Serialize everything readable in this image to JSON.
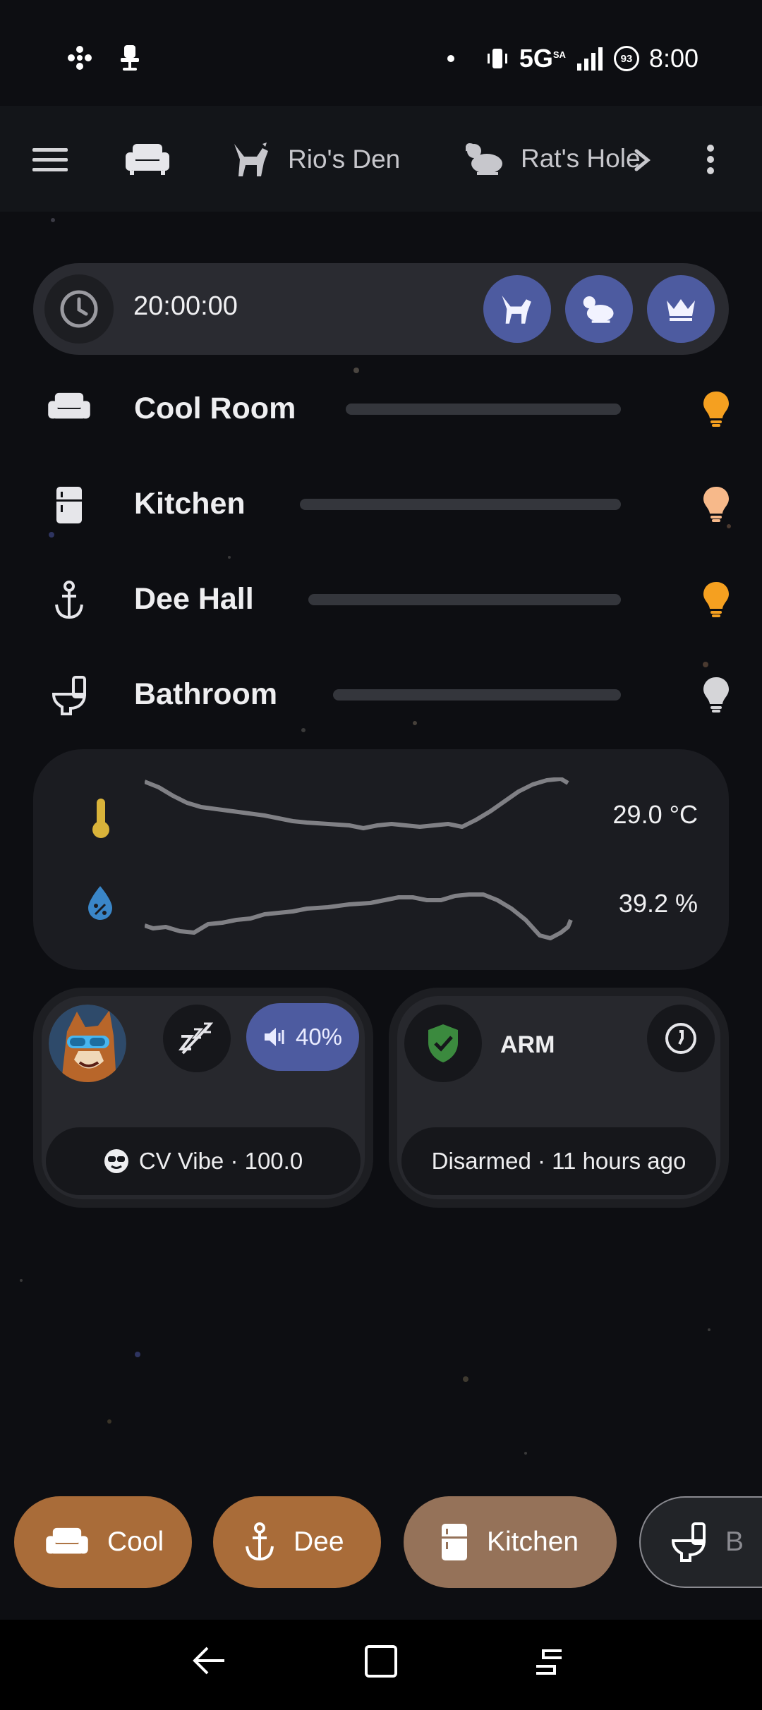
{
  "status_bar": {
    "left_icons": [
      "fan-icon",
      "office-chair-icon"
    ],
    "network": "5G",
    "network_superscript": "SA",
    "battery_level": "93",
    "time": "8:00"
  },
  "top_nav": {
    "menu_icon": "hamburger-icon",
    "home_icon": "sofa-icon",
    "tabs": [
      {
        "icon": "dog-icon",
        "label": "Rio's Den"
      },
      {
        "icon": "rat-icon",
        "label": "Rat's Hole"
      }
    ],
    "overflow_icon": "more-vert-icon"
  },
  "clock": {
    "time": "20:00:00",
    "buttons": [
      "dog-icon",
      "rat-icon",
      "crown-icon"
    ]
  },
  "rooms": [
    {
      "label": "Cool Room",
      "icon": "sofa-icon",
      "bulb_color": "#f5a020",
      "bulb_on": true
    },
    {
      "label": "Kitchen",
      "icon": "fridge-icon",
      "bulb_color": "#f7b98a",
      "bulb_on": true
    },
    {
      "label": "Dee Hall",
      "icon": "anchor-icon",
      "bulb_color": "#f5a020",
      "bulb_on": true
    },
    {
      "label": "Bathroom",
      "icon": "toilet-icon",
      "bulb_color": "#d5d5d8",
      "bulb_on": false
    }
  ],
  "environment": {
    "temperature": "29.0 °C",
    "humidity": "39.2 %",
    "temperature_color": "#d9b33a",
    "humidity_color": "#3a86c8"
  },
  "media_card": {
    "sleep_icon": "sleep-off-icon",
    "volume_icon": "volume-icon",
    "volume": "40%",
    "vibe_icon": "sunglasses-icon",
    "vibe_label": "CV Vibe · 100.0"
  },
  "alarm_card": {
    "shield_icon": "shield-check-icon",
    "arm_label": "ARM",
    "action_icon": "history-icon",
    "status": "Disarmed · 11 hours ago"
  },
  "chips": [
    {
      "icon": "sofa-icon",
      "label": "Cool",
      "bg": "#a96c39"
    },
    {
      "icon": "anchor-icon",
      "label": "Dee",
      "bg": "#a96c39"
    },
    {
      "icon": "fridge-icon",
      "label": "Kitchen",
      "bg": "#957259"
    },
    {
      "icon": "toilet-icon",
      "label": "B",
      "bg": "#222428"
    }
  ],
  "colors": {
    "accent_blue": "#4d5ba0",
    "card_bg": "#27282d"
  }
}
